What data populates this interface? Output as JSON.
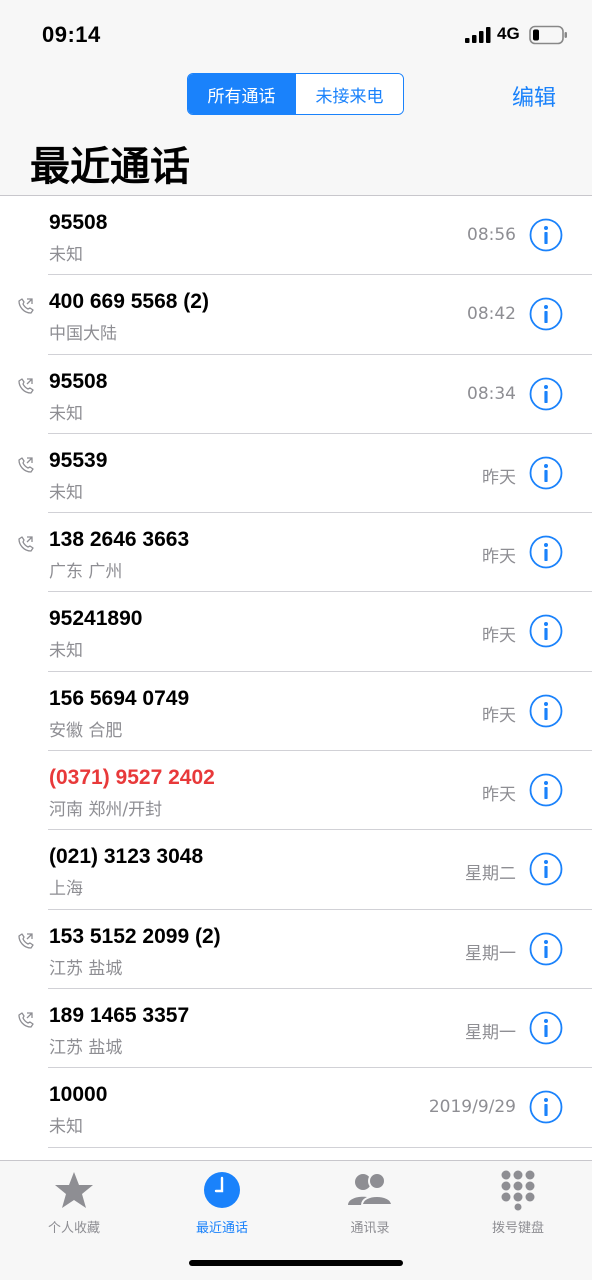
{
  "status": {
    "time": "09:14",
    "network": "4G"
  },
  "header": {
    "segments": [
      "所有通话",
      "未接来电"
    ],
    "selected_segment": "所有通话",
    "edit_label": "编辑",
    "title": "最近通话"
  },
  "calls": [
    {
      "number": "95508",
      "location": "未知",
      "time": "08:56",
      "outgoing": false,
      "missed": false
    },
    {
      "number": "400 669 5568 (2)",
      "location": "中国大陆",
      "time": "08:42",
      "outgoing": true,
      "missed": false
    },
    {
      "number": "95508",
      "location": "未知",
      "time": "08:34",
      "outgoing": true,
      "missed": false
    },
    {
      "number": "95539",
      "location": "未知",
      "time": "昨天",
      "outgoing": true,
      "missed": false
    },
    {
      "number": "138 2646 3663",
      "location": "广东 广州",
      "time": "昨天",
      "outgoing": true,
      "missed": false
    },
    {
      "number": "95241890",
      "location": "未知",
      "time": "昨天",
      "outgoing": false,
      "missed": false
    },
    {
      "number": "156 5694 0749",
      "location": "安徽 合肥",
      "time": "昨天",
      "outgoing": false,
      "missed": false
    },
    {
      "number": "(0371) 9527 2402",
      "location": "河南 郑州/开封",
      "time": "昨天",
      "outgoing": false,
      "missed": true
    },
    {
      "number": "(021) 3123 3048",
      "location": "上海",
      "time": "星期二",
      "outgoing": false,
      "missed": false
    },
    {
      "number": "153 5152 2099 (2)",
      "location": "江苏 盐城",
      "time": "星期一",
      "outgoing": true,
      "missed": false
    },
    {
      "number": "189 1465 3357",
      "location": "江苏 盐城",
      "time": "星期一",
      "outgoing": true,
      "missed": false
    },
    {
      "number": "10000",
      "location": "未知",
      "time": "2019/9/29",
      "outgoing": false,
      "missed": false
    }
  ],
  "tabs": [
    {
      "label": "个人收藏",
      "icon": "star-icon",
      "active": false
    },
    {
      "label": "最近通话",
      "icon": "clock-icon",
      "active": true
    },
    {
      "label": "通讯录",
      "icon": "contacts-icon",
      "active": false
    },
    {
      "label": "拨号键盘",
      "icon": "keypad-icon",
      "active": false
    }
  ],
  "colors": {
    "accent": "#1a82fb",
    "missed": "#e8393a",
    "secondary_text": "#8e8e93"
  }
}
